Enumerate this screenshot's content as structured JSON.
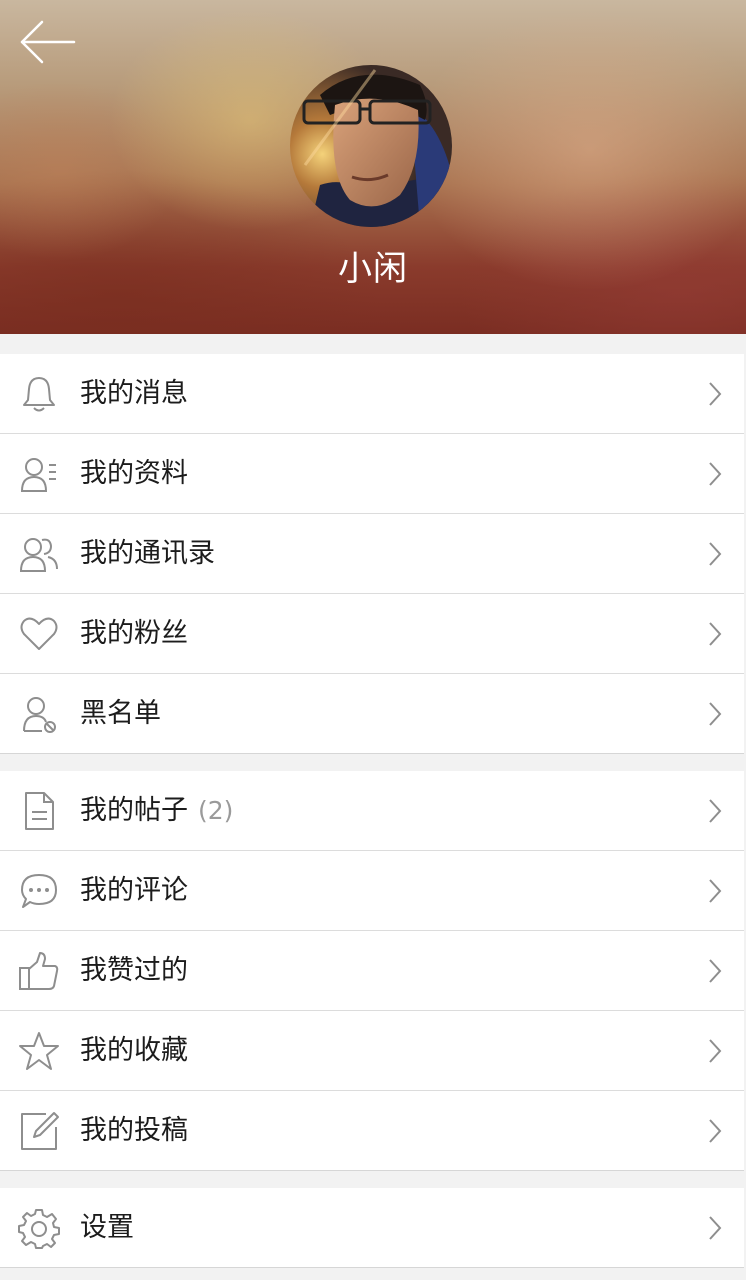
{
  "header": {
    "username": "小闲"
  },
  "groups": [
    {
      "items": [
        {
          "label": "我的消息",
          "icon": "bell-icon"
        },
        {
          "label": "我的资料",
          "icon": "profile-icon"
        },
        {
          "label": "我的通讯录",
          "icon": "contacts-icon"
        },
        {
          "label": "我的粉丝",
          "icon": "heart-icon"
        },
        {
          "label": "黑名单",
          "icon": "blocked-user-icon"
        }
      ]
    },
    {
      "items": [
        {
          "label": "我的帖子",
          "count": "(2)",
          "icon": "document-icon"
        },
        {
          "label": "我的评论",
          "icon": "comment-icon"
        },
        {
          "label": "我赞过的",
          "icon": "thumbs-up-icon"
        },
        {
          "label": "我的收藏",
          "icon": "star-icon"
        },
        {
          "label": "我的投稿",
          "icon": "edit-icon"
        }
      ]
    },
    {
      "items": [
        {
          "label": "设置",
          "icon": "gear-icon"
        }
      ]
    }
  ],
  "colors": {
    "background": "#f2f2f2",
    "row": "#ffffff",
    "divider": "#dcdcdc",
    "icon": "#8e8e8e",
    "text": "#1c1c1c",
    "count": "#9a9a9a"
  }
}
